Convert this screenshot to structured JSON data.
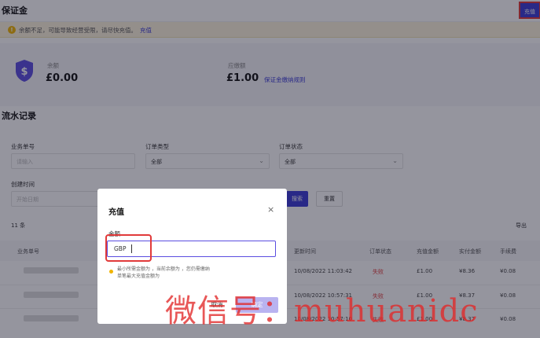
{
  "header": {
    "title": "保证金",
    "recharge_button": "充值"
  },
  "warning": {
    "text": "余额不足，可能导致经营受限，请尽快充值。",
    "link": "充值"
  },
  "balance": {
    "left_label": "余额",
    "left_value": "£0.00",
    "right_label": "应缴额",
    "right_value": "£1.00",
    "rules_link": "保证金缴纳规则"
  },
  "records": {
    "title": "流水记录",
    "filters": {
      "business_no_label": "业务单号",
      "business_no_placeholder": "请输入",
      "order_type_label": "订单类型",
      "order_type_value": "全部",
      "order_status_label": "订单状态",
      "order_status_value": "全部",
      "created_time_label": "创建时间",
      "created_time_placeholder": "开始日期",
      "search_button": "搜索",
      "reset_button": "重置"
    },
    "count": "11 条",
    "export": "导出",
    "columns": [
      "业务单号",
      "更新时间",
      "订单状态",
      "充值金额",
      "实付金额",
      "手续费"
    ],
    "rows": [
      {
        "time": "10/08/2022 11:03:42",
        "status": "失败",
        "amount": "£1.00",
        "paid": "¥8.36",
        "fee": "¥0.08"
      },
      {
        "time": "10/08/2022 10:57:31",
        "status": "失败",
        "amount": "£1.00",
        "paid": "¥8.37",
        "fee": "¥0.08"
      },
      {
        "time": "10/08/2022 10:57:10",
        "status": "失败",
        "amount": "£1.00",
        "paid": "¥8.37",
        "fee": "¥0.08"
      }
    ]
  },
  "modal": {
    "title": "充值",
    "close": "×",
    "amount_label": "金额",
    "currency": "GBP",
    "note_line1": "最小所需金额为     ，当前余额为     ，您仍需缴纳",
    "note_line2": "单笔最大充值金额为",
    "cancel": "取消",
    "confirm": "确定"
  },
  "watermark": "微信号：muhuanidc",
  "colors": {
    "accent": "#3b3bd6",
    "danger": "#e13a3a",
    "warning": "#f0b400"
  }
}
